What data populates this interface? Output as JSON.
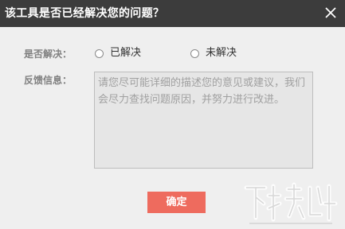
{
  "dialog": {
    "title": "该工具是否已经解决您的问题？"
  },
  "form": {
    "solved_label": "是否解决：",
    "options": [
      {
        "label": "已解决",
        "selected": false
      },
      {
        "label": "未解决",
        "selected": false
      }
    ],
    "feedback_label": "反馈信息：",
    "feedback_placeholder": "请您尽可能详细的描述您的意见或建议，我们会尽力查找问题原因，并努力进行改进。",
    "feedback_value": ""
  },
  "actions": {
    "ok_label": "确定"
  },
  "icons": {
    "close": "close-icon",
    "watermark": "watermark-logo"
  },
  "colors": {
    "titlebar": "#3c3c3c",
    "ok_button": "#ee6b5e"
  }
}
